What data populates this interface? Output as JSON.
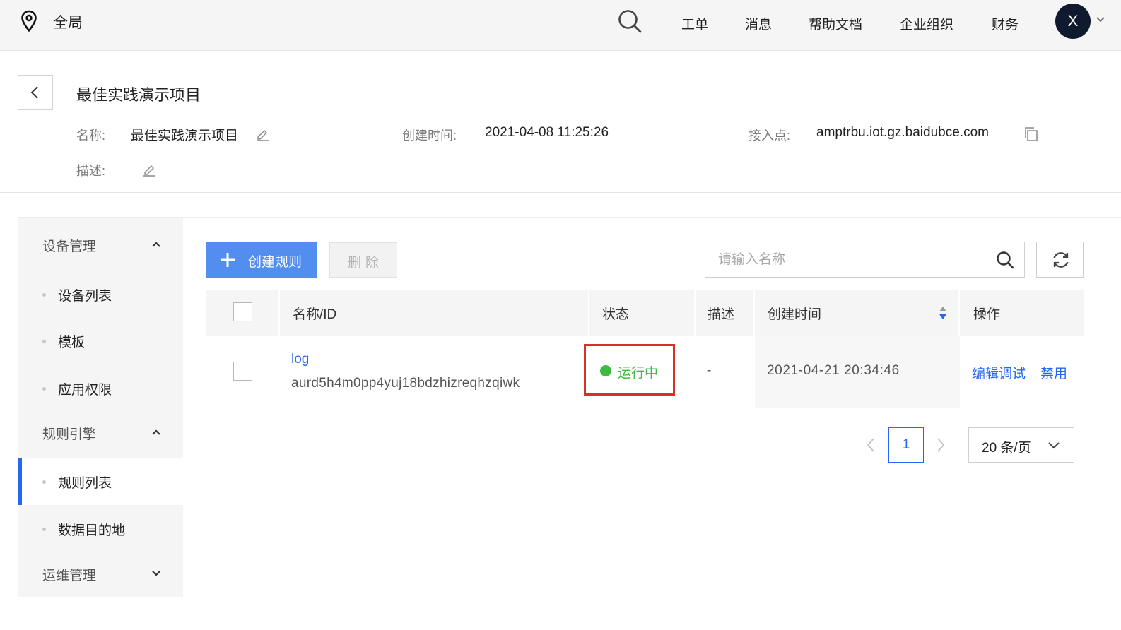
{
  "topbar": {
    "region": "全局",
    "nav": [
      "工单",
      "消息",
      "帮助文档",
      "企业组织",
      "财务"
    ],
    "avatar_letter": "X"
  },
  "project": {
    "title": "最佳实践演示项目",
    "name_label": "名称:",
    "name_value": "最佳实践演示项目",
    "created_label": "创建时间:",
    "created_value": "2021-04-08 11:25:26",
    "endpoint_label": "接入点:",
    "endpoint_value": "amptrbu.iot.gz.baidubce.com",
    "desc_label": "描述:"
  },
  "sidebar": {
    "groups": [
      {
        "label": "设备管理",
        "expanded": true,
        "items": [
          "设备列表",
          "模板",
          "应用权限"
        ]
      },
      {
        "label": "规则引擎",
        "expanded": true,
        "items": [
          "规则列表",
          "数据目的地"
        ]
      },
      {
        "label": "运维管理",
        "expanded": false,
        "items": []
      }
    ],
    "active_item": "规则列表"
  },
  "toolbar": {
    "create_label": "创建规则",
    "delete_label": "删除",
    "search_placeholder": "请输入名称"
  },
  "table": {
    "headers": {
      "name": "名称/ID",
      "status": "状态",
      "desc": "描述",
      "created": "创建时间",
      "actions": "操作"
    },
    "rows": [
      {
        "name": "log",
        "id": "aurd5h4m0pp4yuj18bdzhizreqhzqiwk",
        "status": "运行中",
        "desc": "-",
        "created": "2021-04-21 20:34:46",
        "actions": [
          "编辑调试",
          "禁用"
        ]
      }
    ]
  },
  "pagination": {
    "current_page": "1",
    "page_size": "20 条/页"
  },
  "colors": {
    "primary": "#2468f2",
    "create_button": "#528ef0",
    "status_running": "#43b943",
    "highlight_box": "#d93026"
  }
}
